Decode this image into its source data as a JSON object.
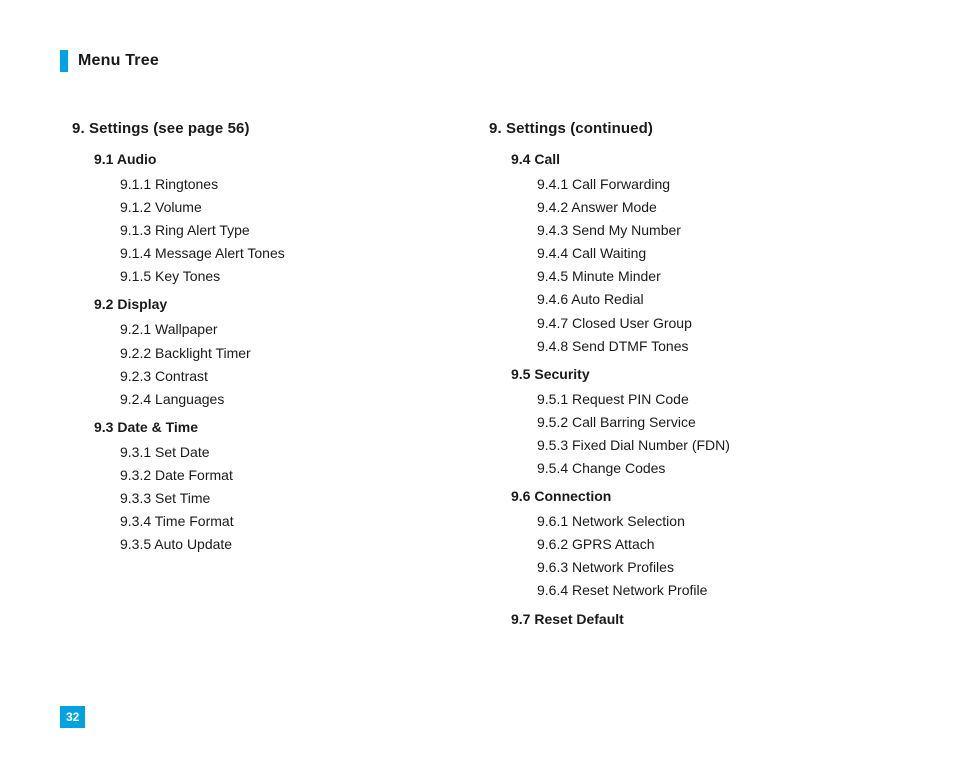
{
  "page_title": "Menu Tree",
  "page_number": "32",
  "left_column": {
    "heading": "9.  Settings (see page 56)",
    "subsections": [
      {
        "title": "9.1 Audio",
        "items": [
          "9.1.1 Ringtones",
          "9.1.2 Volume",
          "9.1.3 Ring Alert Type",
          "9.1.4 Message Alert Tones",
          "9.1.5 Key Tones"
        ]
      },
      {
        "title": "9.2 Display",
        "items": [
          "9.2.1 Wallpaper",
          "9.2.2 Backlight Timer",
          "9.2.3 Contrast",
          "9.2.4 Languages"
        ]
      },
      {
        "title": "9.3 Date & Time",
        "items": [
          "9.3.1 Set Date",
          "9.3.2 Date Format",
          "9.3.3 Set Time",
          "9.3.4 Time Format",
          "9.3.5 Auto Update"
        ]
      }
    ]
  },
  "right_column": {
    "heading": "9.  Settings (continued)",
    "subsections": [
      {
        "title": "9.4 Call",
        "items": [
          "9.4.1 Call Forwarding",
          "9.4.2 Answer Mode",
          "9.4.3 Send My Number",
          "9.4.4 Call Waiting",
          "9.4.5 Minute Minder",
          "9.4.6 Auto Redial",
          "9.4.7 Closed User Group",
          "9.4.8 Send DTMF Tones"
        ]
      },
      {
        "title": "9.5 Security",
        "items": [
          "9.5.1 Request PIN Code",
          "9.5.2 Call Barring Service",
          "9.5.3 Fixed Dial Number (FDN)",
          "9.5.4 Change Codes"
        ]
      },
      {
        "title": "9.6 Connection",
        "items": [
          "9.6.1 Network Selection",
          "9.6.2 GPRS Attach",
          "9.6.3 Network Profiles",
          "9.6.4 Reset Network Profile"
        ]
      },
      {
        "title": "9.7 Reset Default",
        "items": []
      }
    ]
  }
}
